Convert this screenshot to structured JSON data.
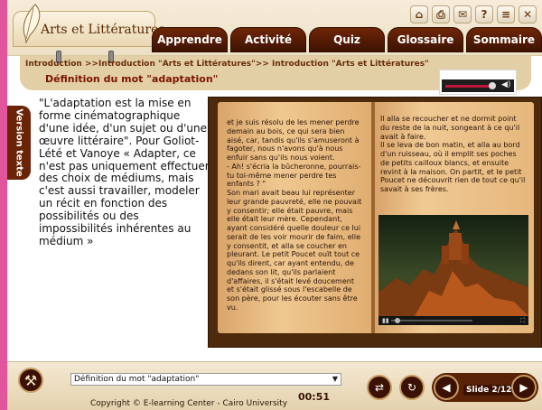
{
  "app": {
    "title": "Arts et Littératures"
  },
  "top_icons": [
    {
      "icon": "home-icon",
      "glyph": "⌂"
    },
    {
      "icon": "print-icon",
      "glyph": "⎙"
    },
    {
      "icon": "mail-icon",
      "glyph": "✉"
    },
    {
      "icon": "help-icon",
      "glyph": "?"
    },
    {
      "icon": "document-icon",
      "glyph": "≡"
    },
    {
      "icon": "close-icon",
      "glyph": "✕"
    }
  ],
  "nav": {
    "tabs": [
      "Apprendre",
      "Activité",
      "Quiz",
      "Glossaire",
      "Sommaire"
    ]
  },
  "breadcrumb": "Introduction >>Introduction \"Arts et Littératures\">> Introduction \"Arts et Littératures\"",
  "page_title": "Définition du mot \"adaptation\"",
  "side_tab": {
    "label": "Version texte"
  },
  "main_text": "\"L'adaptation est la mise en forme cinématographique d'une idée, d'un sujet ou d'une œuvre littéraire\". Pour Goliot-Lété et Vanoye « Adapter, ce n'est pas uniquement effectuer des choix de médiums, mais c'est aussi travailler, modeler un récit en fonction des possibilités ou des impossibilités inhérentes au médium »",
  "book": {
    "left_page": "et je suis résolu de les mener perdre demain au bois, ce qui sera bien aisé, car, tandis qu'ils s'amuseront à fagoter, nous n'avons qu'à nous enfuir sans qu'ils nous voient.\n- Ah! s'écria la bûcheronne, pourrais-tu toi-même mener perdre tes enfants ? \"\n  Son mari avait beau lui représenter leur grande pauvreté, elle ne pouvait y consentir; elle était pauvre, mais elle était leur mère. Cependant, ayant considéré quelle douleur ce lui serait de les voir mourir de faim, elle y consentit, et alla se coucher en pleurant. Le petit Poucet ouït tout ce qu'ils dirent, car ayant entendu, de dedans son lit, qu'ils parlaient d'affaires, il s'était levé doucement et s'était glissé sous l'escabelle de son père, pour les écouter sans être vu.",
    "right_page": "  Il alla se recoucher et ne dormit point du reste de la nuit, songeant à ce qu'il avait à faire.\nIl se leva de bon matin, et alla au bord d'un ruisseau, où il emplit ses poches de petits cailloux blancs, et ensuite revint à la maison. On partit, et le petit Poucet ne découvrit rien de tout ce qu'il savait à ses frères."
  },
  "bottom": {
    "slide_select_value": "Définition du mot \"adaptation\"",
    "timer": "00:51",
    "copyright": "Copyright © E-learning Center - Cairo University",
    "slide_counter": "Slide 2/12"
  },
  "colors": {
    "nav_tab": "#4a1804",
    "accent_pink": "#e0559b",
    "title_red": "#7a1500"
  }
}
